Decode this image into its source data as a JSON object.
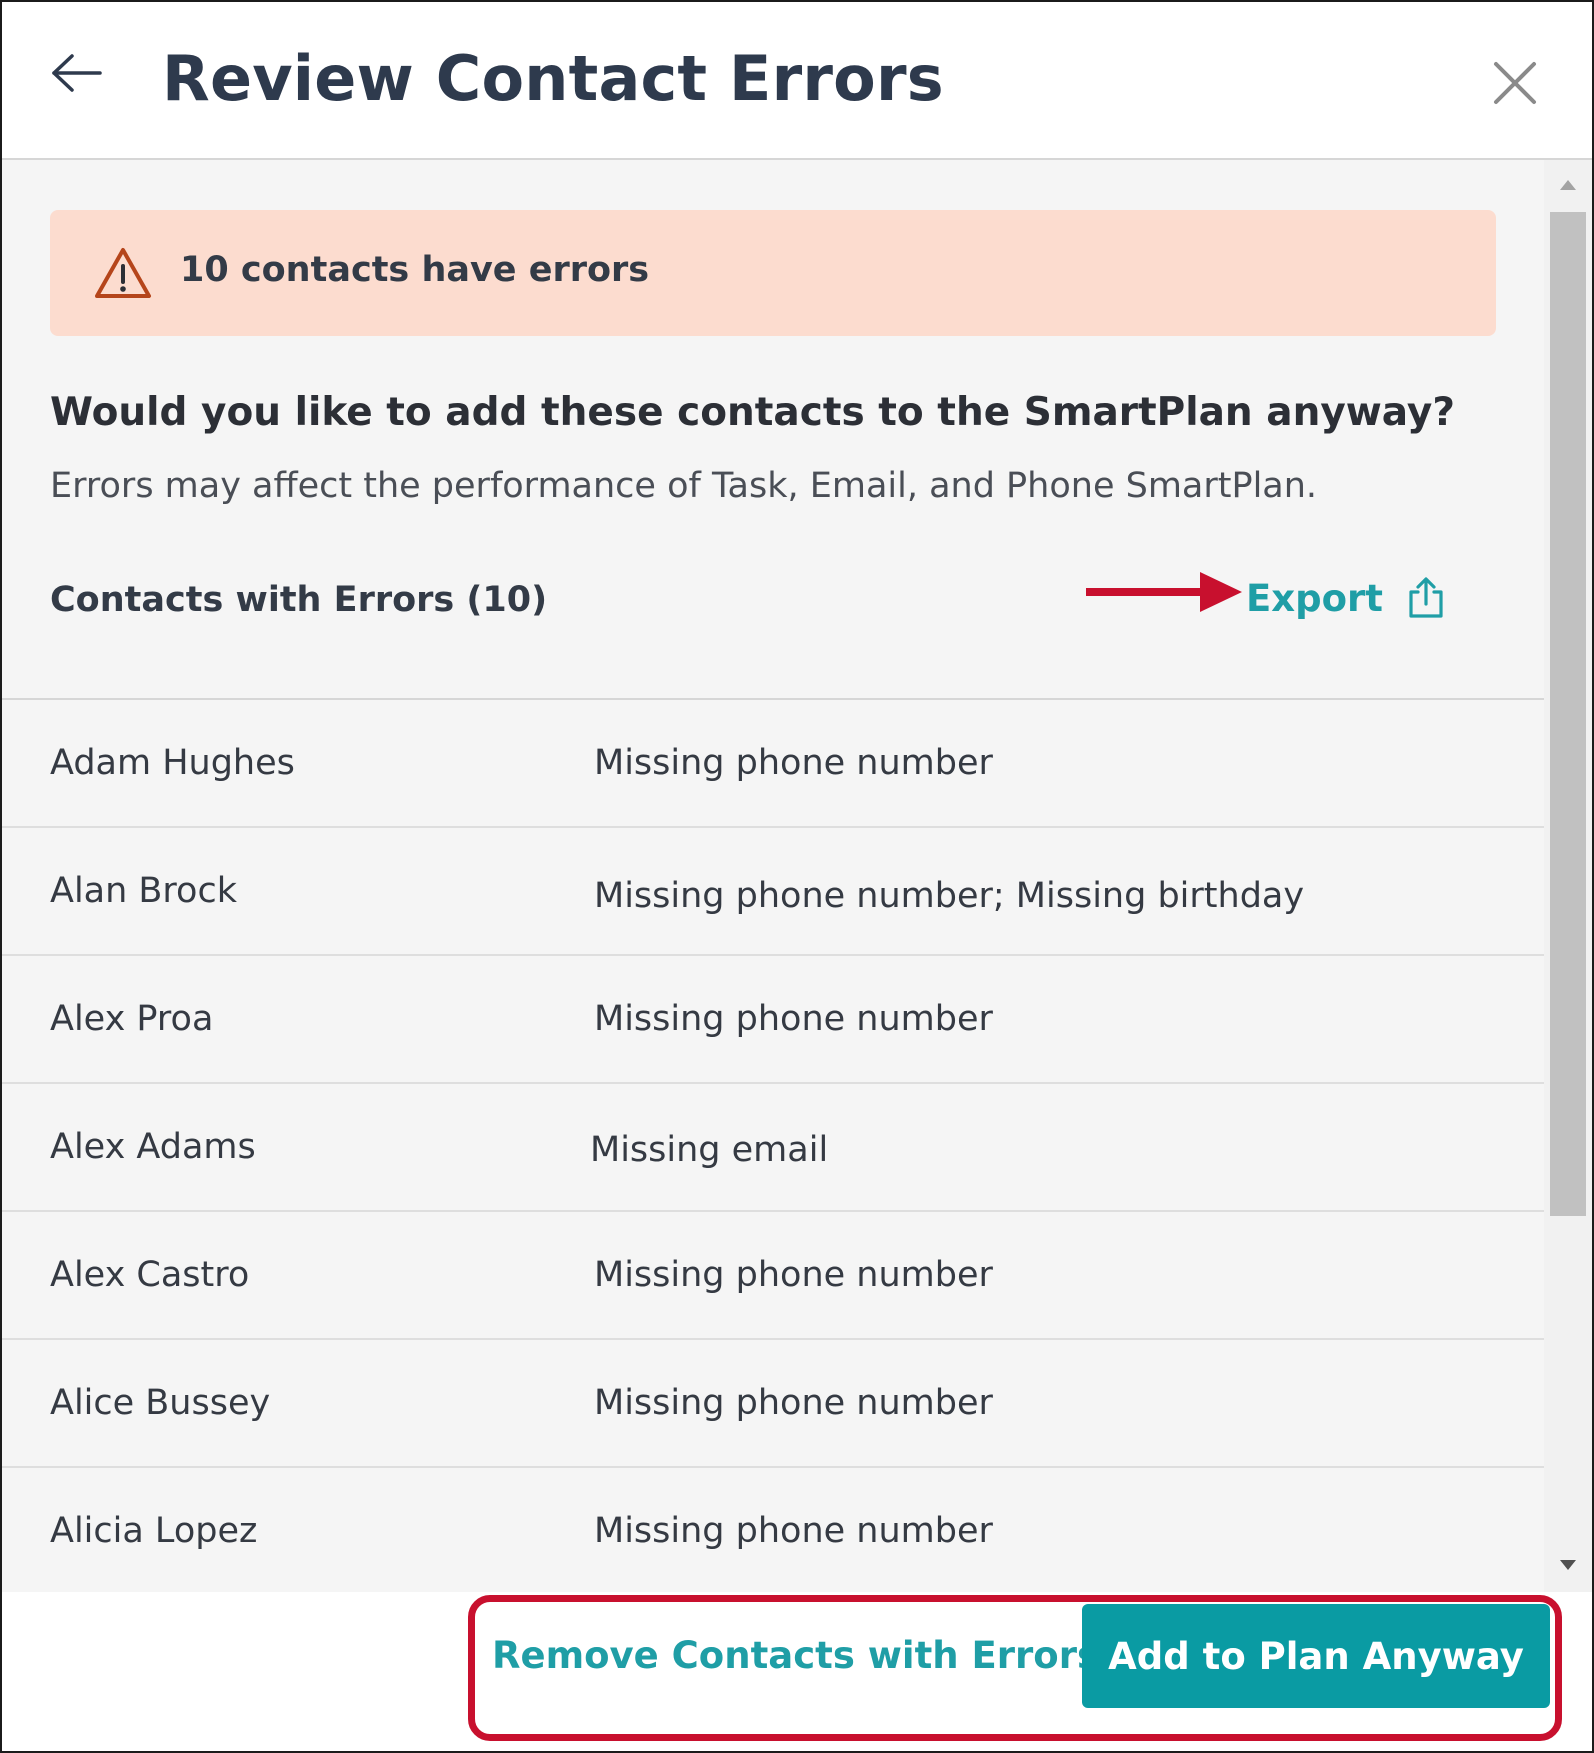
{
  "header": {
    "title": "Review Contact Errors",
    "back_icon": "arrow-left-icon",
    "close_icon": "close-icon"
  },
  "alert": {
    "icon": "warning-triangle-icon",
    "text": "10 contacts have errors",
    "background": "#fcdccf",
    "icon_color": "#b5451b"
  },
  "prompt": {
    "question": "Would you like to add these contacts to the SmartPlan anyway?",
    "description": "Errors may affect the performance of Task, Email, and Phone SmartPlan."
  },
  "contacts_section": {
    "title": "Contacts with Errors (10)",
    "export_label": "Export",
    "export_icon": "share-upload-icon"
  },
  "contacts": [
    {
      "name": "Adam Hughes",
      "error": "Missing phone number"
    },
    {
      "name": "Alan Brock",
      "error": "Missing phone number; Missing birthday"
    },
    {
      "name": "Alex Proa",
      "error": "Missing phone number"
    },
    {
      "name": "Alex Adams",
      "error": "Missing email"
    },
    {
      "name": "Alex Castro",
      "error": "Missing phone number"
    },
    {
      "name": "Alice Bussey",
      "error": "Missing phone number"
    },
    {
      "name": "Alicia Lopez",
      "error": "Missing phone number"
    }
  ],
  "footer": {
    "remove_label": "Remove Contacts with Errors",
    "add_label": "Add to Plan Anyway"
  },
  "colors": {
    "accent": "#0a9ba3",
    "link": "#1f9ea6",
    "annotation": "#c8102e",
    "title_text": "#2e3a4d"
  }
}
